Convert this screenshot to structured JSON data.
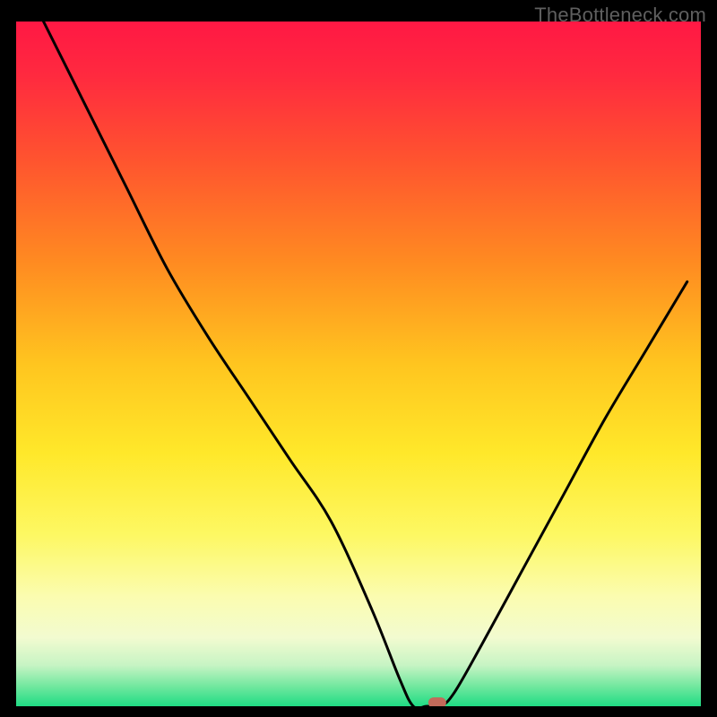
{
  "watermark": "TheBottleneck.com",
  "chart_data": {
    "type": "line",
    "title": "",
    "xlabel": "",
    "ylabel": "",
    "xlim": [
      0,
      100
    ],
    "ylim": [
      0,
      100
    ],
    "grid": false,
    "legend": false,
    "series": [
      {
        "name": "curve",
        "x": [
          4,
          10,
          16,
          22,
          28,
          34,
          40,
          46,
          52,
          56,
          58,
          60,
          62,
          64,
          68,
          74,
          80,
          86,
          92,
          98
        ],
        "y": [
          100,
          88,
          76,
          64,
          54,
          45,
          36,
          27,
          14,
          4,
          0,
          0,
          0,
          2,
          9,
          20,
          31,
          42,
          52,
          62
        ]
      }
    ],
    "marker": {
      "x": 61.5,
      "y": 0.5,
      "color": "#c26a5a"
    },
    "gradient_stops": [
      {
        "offset": 0.0,
        "color": "#ff1844"
      },
      {
        "offset": 0.08,
        "color": "#ff2a3f"
      },
      {
        "offset": 0.2,
        "color": "#ff532f"
      },
      {
        "offset": 0.35,
        "color": "#ff8a21"
      },
      {
        "offset": 0.5,
        "color": "#ffc51f"
      },
      {
        "offset": 0.63,
        "color": "#ffe82a"
      },
      {
        "offset": 0.75,
        "color": "#fdf863"
      },
      {
        "offset": 0.84,
        "color": "#fbfcb0"
      },
      {
        "offset": 0.9,
        "color": "#f2fbd0"
      },
      {
        "offset": 0.94,
        "color": "#c7f4c4"
      },
      {
        "offset": 0.97,
        "color": "#74e8a0"
      },
      {
        "offset": 1.0,
        "color": "#1fdc84"
      }
    ]
  }
}
